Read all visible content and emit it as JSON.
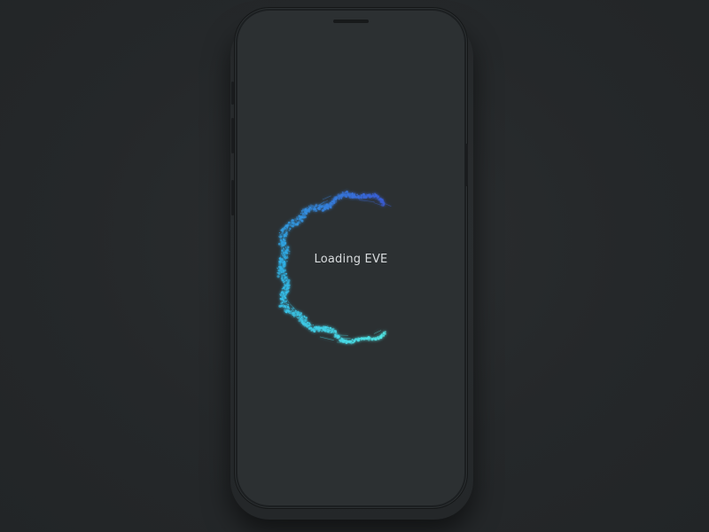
{
  "loading": {
    "text": "Loading EVE"
  },
  "colors": {
    "background": "#25282a",
    "screen": "#2c3032",
    "text": "#d9dcde",
    "arc_start": "#3a5bd6",
    "arc_mid": "#2fb4e8",
    "arc_end": "#52e8e6"
  },
  "icons": {
    "loader": "particle-arc-spinner-icon"
  }
}
